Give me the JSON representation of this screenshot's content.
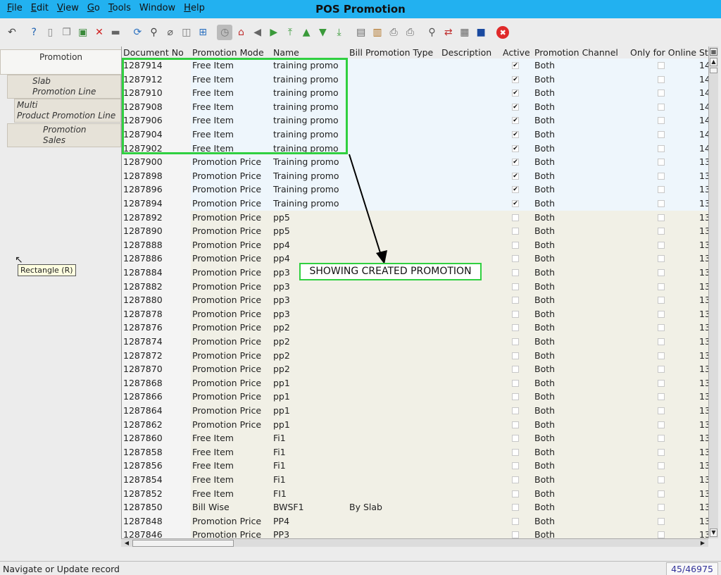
{
  "window": {
    "title": "POS Promotion"
  },
  "menu": [
    {
      "label": "File",
      "u": "F",
      "rest": "ile"
    },
    {
      "label": "Edit",
      "u": "E",
      "rest": "dit"
    },
    {
      "label": "View",
      "u": "V",
      "rest": "iew"
    },
    {
      "label": "Go",
      "u": "G",
      "rest": "o"
    },
    {
      "label": "Tools",
      "u": "T",
      "rest": "ools"
    },
    {
      "label": "Window",
      "u": "",
      "rest": "Window"
    },
    {
      "label": "Help",
      "u": "H",
      "rest": "elp"
    }
  ],
  "toolbar": [
    {
      "icon": "undo-icon",
      "glyph": "↶",
      "color": "#444"
    },
    {
      "icon": "help-icon",
      "glyph": "?",
      "color": "#1a5fb0"
    },
    {
      "icon": "new-icon",
      "glyph": "▯",
      "color": "#888"
    },
    {
      "icon": "copy-icon",
      "glyph": "❐",
      "color": "#888"
    },
    {
      "icon": "save-icon",
      "glyph": "▣",
      "color": "#3a8a3a"
    },
    {
      "icon": "delete-icon",
      "glyph": "✕",
      "color": "#d02020"
    },
    {
      "icon": "save-disk-icon",
      "glyph": "▬",
      "color": "#666"
    },
    {
      "icon": "refresh-icon",
      "glyph": "⟳",
      "color": "#2a70c0"
    },
    {
      "icon": "find-icon",
      "glyph": "⚲",
      "color": "#444"
    },
    {
      "icon": "attachment-icon",
      "glyph": "⌀",
      "color": "#555"
    },
    {
      "icon": "chat-icon",
      "glyph": "◫",
      "color": "#777"
    },
    {
      "icon": "grid-toggle-icon",
      "glyph": "⊞",
      "color": "#2a70c0"
    },
    {
      "icon": "history-icon",
      "glyph": "◷",
      "color": "#777"
    },
    {
      "icon": "home-icon",
      "glyph": "⌂",
      "color": "#c03030"
    },
    {
      "icon": "parent-record-icon",
      "glyph": "◀",
      "color": "#666"
    },
    {
      "icon": "detail-record-icon",
      "glyph": "▶",
      "color": "#3a9a3a"
    },
    {
      "icon": "first-record-icon",
      "glyph": "⤒",
      "color": "#3a9a3a"
    },
    {
      "icon": "previous-record-icon",
      "glyph": "▲",
      "color": "#3a9a3a"
    },
    {
      "icon": "next-record-icon",
      "glyph": "▼",
      "color": "#3a9a3a"
    },
    {
      "icon": "last-record-icon",
      "glyph": "⤓",
      "color": "#3a9a3a"
    },
    {
      "icon": "report-icon",
      "glyph": "▤",
      "color": "#666"
    },
    {
      "icon": "archive-icon",
      "glyph": "▥",
      "color": "#b07020"
    },
    {
      "icon": "print-preview-icon",
      "glyph": "⎙",
      "color": "#666"
    },
    {
      "icon": "print-icon",
      "glyph": "⎙",
      "color": "#666"
    },
    {
      "icon": "zoom-across-icon",
      "glyph": "⚲",
      "color": "#555"
    },
    {
      "icon": "workflow-icon",
      "glyph": "⇄",
      "color": "#c03030"
    },
    {
      "icon": "product-info-icon",
      "glyph": "▦",
      "color": "#666"
    },
    {
      "icon": "lock-icon",
      "glyph": "■",
      "color": "#1a4aa0"
    },
    {
      "icon": "close-icon",
      "glyph": "✖",
      "color": "#d02020"
    }
  ],
  "tabs": {
    "promotion": "Promotion",
    "slab_1": "Slab",
    "slab_2": "Promotion Line",
    "multi_1": "Multi",
    "multi_2": "Product Promotion Line",
    "sales_1": "Promotion",
    "sales_2": "Sales"
  },
  "columns": {
    "doc": "Document No",
    "mode": "Promotion Mode",
    "name": "Name",
    "bill": "Bill Promotion Type",
    "desc": "Description",
    "active": "Active",
    "channel": "Promotion Channel",
    "online": "Only for Online",
    "st": "St"
  },
  "rows": [
    {
      "doc": "1287914",
      "mode": "Free Item",
      "name": "training promo",
      "bill": "",
      "active": true,
      "channel": "Both",
      "st": "14"
    },
    {
      "doc": "1287912",
      "mode": "Free Item",
      "name": "training promo",
      "bill": "",
      "active": true,
      "channel": "Both",
      "st": "14"
    },
    {
      "doc": "1287910",
      "mode": "Free Item",
      "name": "training promo",
      "bill": "",
      "active": true,
      "channel": "Both",
      "st": "14"
    },
    {
      "doc": "1287908",
      "mode": "Free Item",
      "name": "training promo",
      "bill": "",
      "active": true,
      "channel": "Both",
      "st": "14"
    },
    {
      "doc": "1287906",
      "mode": "Free Item",
      "name": "training promo",
      "bill": "",
      "active": true,
      "channel": "Both",
      "st": "14"
    },
    {
      "doc": "1287904",
      "mode": "Free Item",
      "name": "training promo",
      "bill": "",
      "active": true,
      "channel": "Both",
      "st": "14"
    },
    {
      "doc": "1287902",
      "mode": "Free Item",
      "name": "training promo",
      "bill": "",
      "active": true,
      "channel": "Both",
      "st": "14"
    },
    {
      "doc": "1287900",
      "mode": "Promotion Price",
      "name": "Training promo",
      "bill": "",
      "active": true,
      "channel": "Both",
      "st": "13"
    },
    {
      "doc": "1287898",
      "mode": "Promotion Price",
      "name": "Training promo",
      "bill": "",
      "active": true,
      "channel": "Both",
      "st": "13"
    },
    {
      "doc": "1287896",
      "mode": "Promotion Price",
      "name": "Training promo",
      "bill": "",
      "active": true,
      "channel": "Both",
      "st": "13"
    },
    {
      "doc": "1287894",
      "mode": "Promotion Price",
      "name": "Training promo",
      "bill": "",
      "active": true,
      "channel": "Both",
      "st": "13"
    },
    {
      "doc": "1287892",
      "mode": "Promotion Price",
      "name": "pp5",
      "bill": "",
      "active": false,
      "channel": "Both",
      "st": "13"
    },
    {
      "doc": "1287890",
      "mode": "Promotion Price",
      "name": "pp5",
      "bill": "",
      "active": false,
      "channel": "Both",
      "st": "13"
    },
    {
      "doc": "1287888",
      "mode": "Promotion Price",
      "name": "pp4",
      "bill": "",
      "active": false,
      "channel": "Both",
      "st": "13"
    },
    {
      "doc": "1287886",
      "mode": "Promotion Price",
      "name": "pp4",
      "bill": "",
      "active": false,
      "channel": "Both",
      "st": "13"
    },
    {
      "doc": "1287884",
      "mode": "Promotion Price",
      "name": "pp3",
      "bill": "",
      "active": false,
      "channel": "Both",
      "st": "13"
    },
    {
      "doc": "1287882",
      "mode": "Promotion Price",
      "name": "pp3",
      "bill": "",
      "active": false,
      "channel": "Both",
      "st": "13"
    },
    {
      "doc": "1287880",
      "mode": "Promotion Price",
      "name": "pp3",
      "bill": "",
      "active": false,
      "channel": "Both",
      "st": "13"
    },
    {
      "doc": "1287878",
      "mode": "Promotion Price",
      "name": "pp3",
      "bill": "",
      "active": false,
      "channel": "Both",
      "st": "13"
    },
    {
      "doc": "1287876",
      "mode": "Promotion Price",
      "name": "pp2",
      "bill": "",
      "active": false,
      "channel": "Both",
      "st": "13"
    },
    {
      "doc": "1287874",
      "mode": "Promotion Price",
      "name": "pp2",
      "bill": "",
      "active": false,
      "channel": "Both",
      "st": "13"
    },
    {
      "doc": "1287872",
      "mode": "Promotion Price",
      "name": "pp2",
      "bill": "",
      "active": false,
      "channel": "Both",
      "st": "13"
    },
    {
      "doc": "1287870",
      "mode": "Promotion Price",
      "name": "pp2",
      "bill": "",
      "active": false,
      "channel": "Both",
      "st": "13"
    },
    {
      "doc": "1287868",
      "mode": "Promotion Price",
      "name": "pp1",
      "bill": "",
      "active": false,
      "channel": "Both",
      "st": "13"
    },
    {
      "doc": "1287866",
      "mode": "Promotion Price",
      "name": "pp1",
      "bill": "",
      "active": false,
      "channel": "Both",
      "st": "13"
    },
    {
      "doc": "1287864",
      "mode": "Promotion Price",
      "name": "pp1",
      "bill": "",
      "active": false,
      "channel": "Both",
      "st": "13"
    },
    {
      "doc": "1287862",
      "mode": "Promotion Price",
      "name": "pp1",
      "bill": "",
      "active": false,
      "channel": "Both",
      "st": "13"
    },
    {
      "doc": "1287860",
      "mode": "Free Item",
      "name": "Fi1",
      "bill": "",
      "active": false,
      "channel": "Both",
      "st": "13"
    },
    {
      "doc": "1287858",
      "mode": "Free Item",
      "name": "Fi1",
      "bill": "",
      "active": false,
      "channel": "Both",
      "st": "13"
    },
    {
      "doc": "1287856",
      "mode": "Free Item",
      "name": "Fi1",
      "bill": "",
      "active": false,
      "channel": "Both",
      "st": "13"
    },
    {
      "doc": "1287854",
      "mode": "Free Item",
      "name": "Fi1",
      "bill": "",
      "active": false,
      "channel": "Both",
      "st": "13"
    },
    {
      "doc": "1287852",
      "mode": "Free Item",
      "name": "FI1",
      "bill": "",
      "active": false,
      "channel": "Both",
      "st": "13"
    },
    {
      "doc": "1287850",
      "mode": "Bill Wise",
      "name": "BWSF1",
      "bill": "By Slab",
      "active": false,
      "channel": "Both",
      "st": "13"
    },
    {
      "doc": "1287848",
      "mode": "Promotion Price",
      "name": "PP4",
      "bill": "",
      "active": false,
      "channel": "Both",
      "st": "13"
    },
    {
      "doc": "1287846",
      "mode": "Promotion Price",
      "name": "PP3",
      "bill": "",
      "active": false,
      "channel": "Both",
      "st": "13"
    }
  ],
  "annotation": "SHOWING CREATED PROMOTION",
  "tooltip": "Rectangle (R)",
  "status": {
    "text": "Navigate or Update record",
    "count": "45/46975"
  },
  "colors": {
    "active_row": "#eef6fc",
    "inactive_row": "#f1f0e6",
    "doc_bg": "#f4f4f4",
    "highlight": "#30d040"
  }
}
